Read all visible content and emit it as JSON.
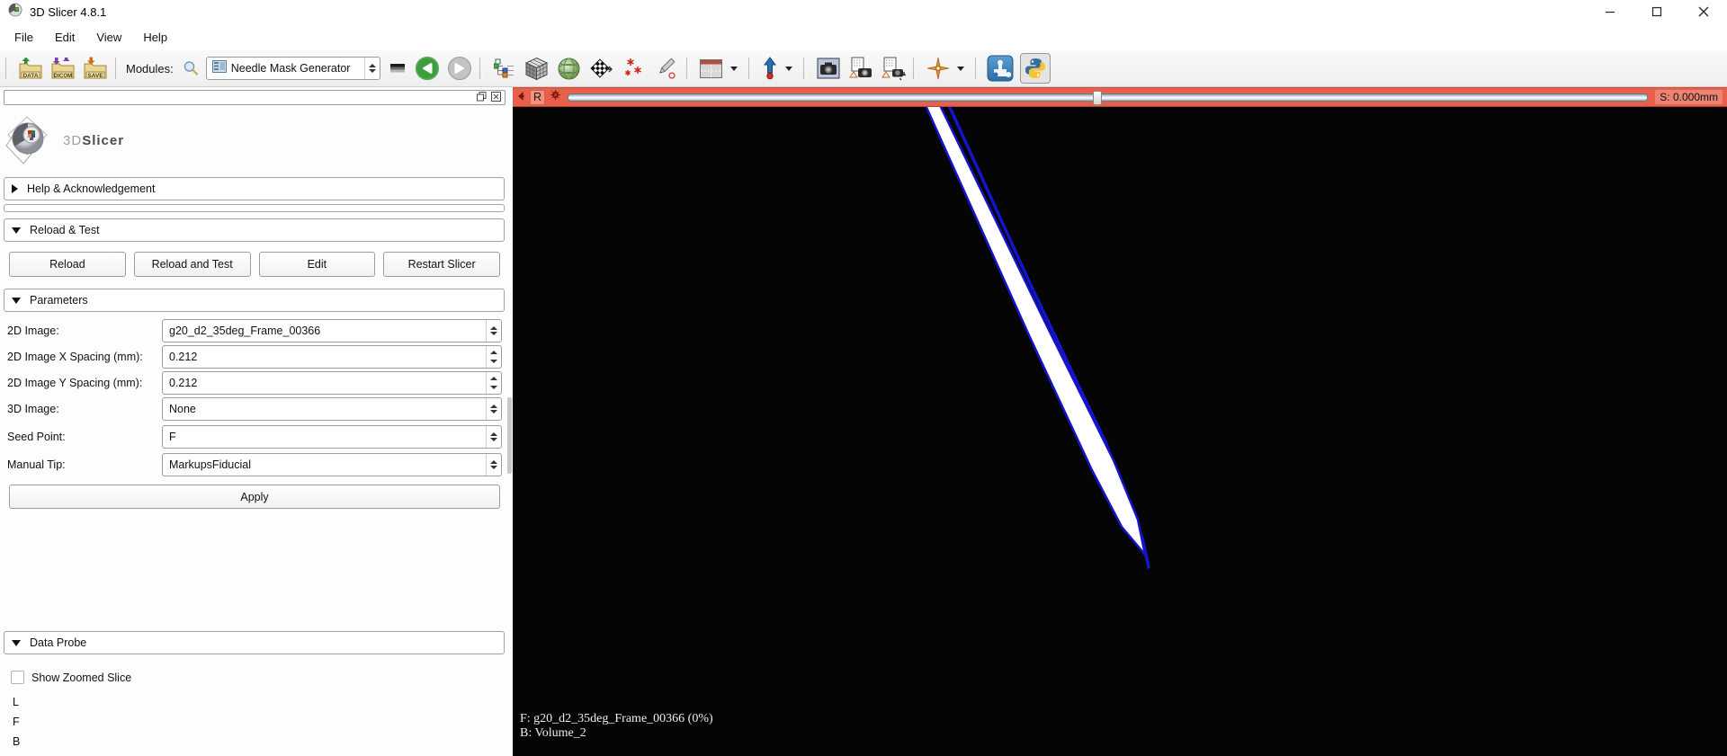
{
  "window": {
    "title": "3D Slicer 4.8.1"
  },
  "menubar": {
    "items": [
      "File",
      "Edit",
      "View",
      "Help"
    ]
  },
  "toolbar": {
    "modules_label": "Modules:",
    "module_selector_value": "Needle Mask Generator",
    "file_badges": {
      "data": "DATA",
      "dicom": "DICOM",
      "save": "SAVE"
    }
  },
  "module_panel": {
    "logo": {
      "part1": "3D",
      "part2": "Slicer"
    },
    "help_section_label": "Help & Acknowledgement",
    "reload_section": {
      "label": "Reload & Test",
      "buttons": [
        "Reload",
        "Reload and Test",
        "Edit",
        "Restart Slicer"
      ]
    },
    "parameters_section": {
      "label": "Parameters",
      "fields": {
        "image_2d": {
          "label": "2D Image:",
          "value": "g20_d2_35deg_Frame_00366"
        },
        "x_spacing": {
          "label": "2D Image X Spacing (mm):",
          "value": "0.212"
        },
        "y_spacing": {
          "label": "2D Image Y Spacing (mm):",
          "value": "0.212"
        },
        "image_3d": {
          "label": "3D Image:",
          "value": "None"
        },
        "seed_point": {
          "label": "Seed Point:",
          "value": "F"
        },
        "manual_tip": {
          "label": "Manual Tip:",
          "value": "MarkupsFiducial"
        }
      },
      "apply_label": "Apply"
    },
    "data_probe_section": {
      "label": "Data Probe",
      "show_zoomed_slice_label": "Show Zoomed Slice",
      "probe_rows": [
        "L",
        "F",
        "B"
      ]
    }
  },
  "slice_view": {
    "orientation_marker": "R",
    "slice_offset_label": "S: 0.000mm",
    "foreground_text": "F: g20_d2_35deg_Frame_00366 (0%)",
    "background_text": "B: Volume_2"
  },
  "colors": {
    "slice_bar": "#e8604b",
    "needle_outline": "#1414cc",
    "needle_fill": "#ffffff",
    "view_background": "#050505"
  }
}
